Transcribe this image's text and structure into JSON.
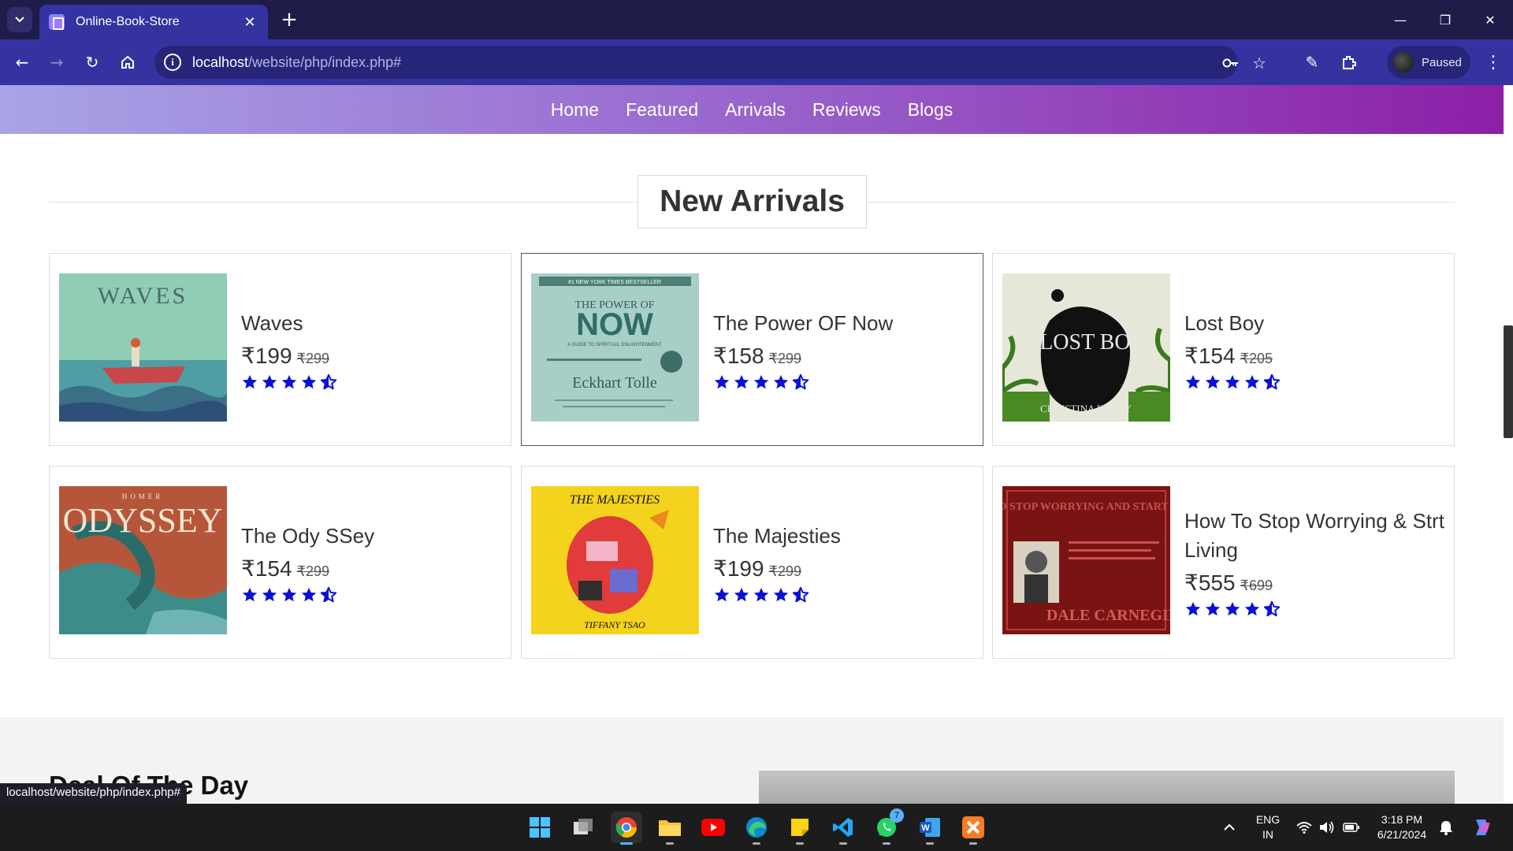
{
  "browser": {
    "tab_title": "Online-Book-Store",
    "url_host": "localhost",
    "url_path": "/website/php/index.php#",
    "profile_label": "Paused",
    "status_url": "localhost/website/php/index.php#"
  },
  "site_nav": [
    "Home",
    "Featured",
    "Arrivals",
    "Reviews",
    "Blogs"
  ],
  "section_heading": "New Arrivals",
  "currency": "₹",
  "star_color": "#0b10d6",
  "rating_stars": 4.5,
  "books": [
    {
      "title": "Waves",
      "price": "₹199",
      "old_price": "₹299"
    },
    {
      "title": "The Power OF Now",
      "price": "₹158",
      "old_price": "₹299"
    },
    {
      "title": "Lost Boy",
      "price": "₹154",
      "old_price": "₹205"
    },
    {
      "title": "The Ody SSey",
      "price": "₹154",
      "old_price": "₹299"
    },
    {
      "title": "The Majesties",
      "price": "₹199",
      "old_price": "₹299"
    },
    {
      "title": "How To Stop Worrying & Strt Living",
      "price": "₹555",
      "old_price": "₹699"
    }
  ],
  "covers": {
    "waves": "WAVES",
    "power_of_now_top": "#1 NEW YORK TIMES BESTSELLER",
    "power_of_now_a": "THE POWER OF",
    "power_of_now_b": "NOW",
    "power_of_now_sub": "A GUIDE TO SPIRITUAL ENLIGHTENMENT",
    "power_of_now_author": "Eckhart Tolle",
    "lost_boy": "LOST BOY",
    "lost_boy_author": "CHRISTINA HENRY",
    "odyssey": "ODYSSEY",
    "odyssey_top": "HOMER",
    "majesties": "THE MAJESTIES",
    "majesties_author": "TIFFANY TSAO",
    "carnegie_title": "HOW TO STOP WORRYING AND START LIVING",
    "carnegie_author": "DALE CARNEGIE"
  },
  "deal_heading": "Deal Of The Day",
  "taskbar": {
    "language_top": "ENG",
    "language_bottom": "IN",
    "time": "3:18 PM",
    "date": "6/21/2024",
    "whatsapp_badge": "7"
  }
}
